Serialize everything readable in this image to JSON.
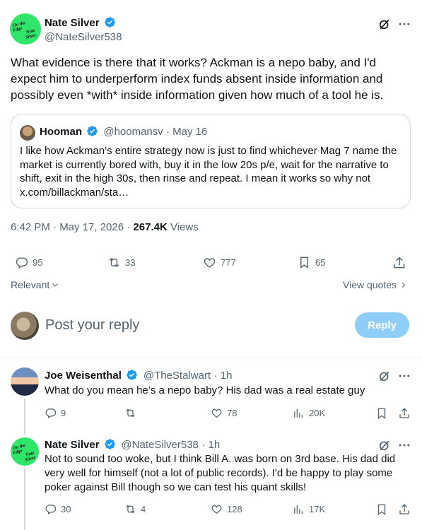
{
  "main_tweet": {
    "author_name": "Nate Silver",
    "author_handle": "@NateSilver538",
    "avatar_text": [
      "On the",
      "Edge",
      "Nate",
      "Silver"
    ],
    "text": "What evidence is there that it works? Ackman is a nepo baby, and I'd expect him to underperform index funds absent inside information and possibly even *with* inside information given how much of a tool he is.",
    "timestamp": "6:42 PM · May 17, 2026 · ",
    "views_count": "267.4K",
    "views_label": " Views",
    "stats": {
      "replies": "95",
      "reposts": "33",
      "likes": "777",
      "bookmarks": "65"
    }
  },
  "quoted_tweet": {
    "author_name": "Hooman",
    "author_handle": "@hoomansv",
    "date": "· May 16",
    "text": "I like how Ackman’s entire strategy now is just to find whichever Mag 7 name the market is currently bored with, buy it in the low 20s p/e, wait for the narrative to shift, exit in the high 30s, then rinse and repeat. I mean it works so why not x.com/billackman/sta…"
  },
  "sort": {
    "label": "Relevant",
    "view_quotes": "View quotes"
  },
  "composer": {
    "placeholder": "Post your reply",
    "reply_button": "Reply"
  },
  "replies": [
    {
      "author_name": "Joe Weisenthal",
      "author_handle": "@TheStalwart",
      "time": "· 1h",
      "text": "What do you mean he’s a nepo baby? His dad was a real estate guy",
      "stats": {
        "replies": "9",
        "reposts": "",
        "likes": "78",
        "views": "20K"
      }
    },
    {
      "author_name": "Nate Silver",
      "author_handle": "@NateSilver538",
      "time": "· 1h",
      "text": "Not to sound too woke, but I think Bill A. was born on 3rd base. His dad did very well for himself (not a lot of public records). I'd be happy to play some poker against Bill though so we can test his quant skills!",
      "stats": {
        "replies": "30",
        "reposts": "4",
        "likes": "128",
        "views": "17K"
      }
    }
  ],
  "colors": {
    "accent": "#1d9bf0",
    "secondary_text": "#536471",
    "avatar_green": "#2fe66b",
    "reply_button_bg": "#8ecdf7"
  }
}
